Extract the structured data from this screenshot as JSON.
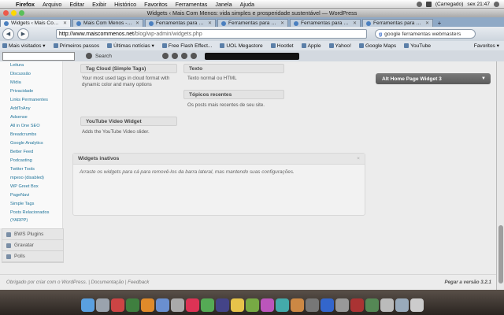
{
  "menubar": {
    "app": "Firefox",
    "items": [
      "Arquivo",
      "Editar",
      "Exibir",
      "Histórico",
      "Favoritos",
      "Ferramentas",
      "Janela",
      "Ajuda"
    ],
    "status": "(Carregado)",
    "clock": "sex 21:47"
  },
  "window": {
    "title": "Widgets ‹ Mais Com Menos: vida simples e prosperidade sustentável — WordPress"
  },
  "tabs": [
    {
      "label": "Widgets ‹ Mais Com Men..."
    },
    {
      "label": "Mais Com Menos - Vid..."
    },
    {
      "label": "Ferramentas para web..."
    },
    {
      "label": "Ferramentas para web..."
    },
    {
      "label": "Ferramentas para web..."
    },
    {
      "label": "Ferramentas para web..."
    }
  ],
  "nav": {
    "url_domain": "http://www.maiscommenos.net",
    "url_path": "/blog/wp-admin/widgets.php",
    "search_value": "google ferramentas webmasters"
  },
  "bookmarks": [
    "Mais visitados ▾",
    "Primeiros passos",
    "Últimas notícias ▾",
    "Free Flash Effect...",
    "UOL Megastore",
    "Hootlet",
    "Apple",
    "Yahoo!",
    "Google Maps",
    "YouTube"
  ],
  "bookmarks_right": "Favoritos ▾",
  "toolbar": {
    "search_label": "Search"
  },
  "sidebar": {
    "menu": [
      "Leitura",
      "Discussão",
      "Mídia",
      "Privacidade",
      "Links Permanentes",
      "AddToAny",
      "Adsense",
      "All in One SEO",
      "Breadcrumbs",
      "Google Analytics",
      "Better Feed",
      "Podcasting",
      "Twitter Tools",
      "mpexo (disabled)",
      "WP Greet Box",
      "PageNavi",
      "Simple Tags",
      "Posts Relacionados",
      "(YARPP)"
    ],
    "bottom": [
      "BWS Plugins",
      "Gravatar",
      "Polls"
    ]
  },
  "widgets": {
    "tag_cloud": {
      "title": "Tag Cloud (Simple Tags)",
      "desc": "Your most used tags in cloud format with dynamic color and many options"
    },
    "youtube": {
      "title": "YouTube Video Widget",
      "desc": "Adds the YouTube Video slider."
    },
    "texto": {
      "title": "Texto",
      "desc": "Texto normal ou HTML"
    },
    "topicos": {
      "title": "Tópicos recentes",
      "desc": "Os posts mais recentes de seu site."
    }
  },
  "sidebar_area": {
    "title": "Alt Home Page Widget 3"
  },
  "inactive": {
    "title": "Widgets inativos",
    "desc": "Arraste os widgets para cá para removê-los da barra lateral, mas mantendo suas configurações."
  },
  "footer": {
    "left": "Obrigado por criar com o WordPress. | Documentação | Feedback",
    "right": "Pegar a versão 3.2.1"
  },
  "colors": {
    "link": "#21759b",
    "alt_bar": "#666666",
    "tab_strip": "#8fa9c6"
  }
}
